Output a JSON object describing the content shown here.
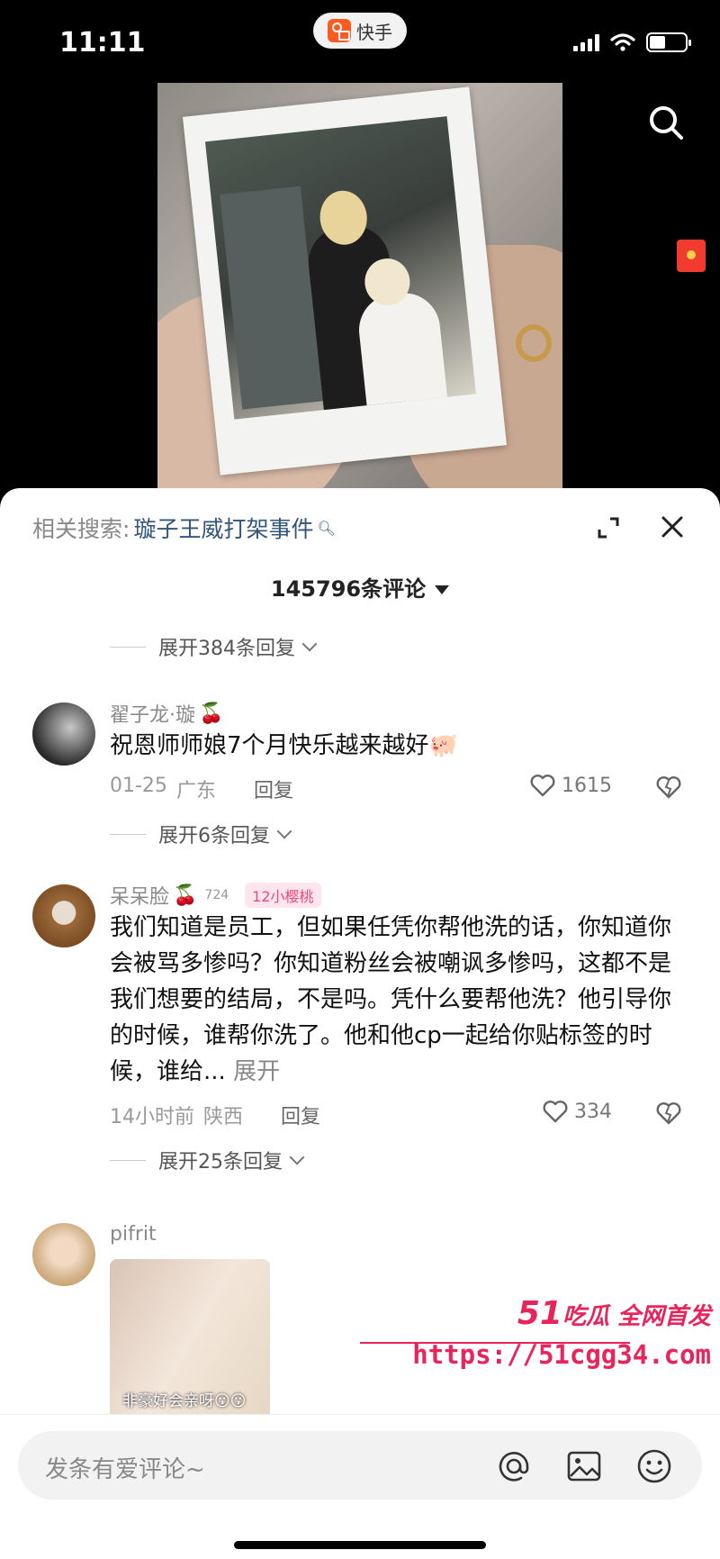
{
  "status_bar": {
    "time": "11:11",
    "app_name": "快手"
  },
  "related_search": {
    "label": "相关搜索:",
    "keyword": "璇子王威打架事件"
  },
  "comments_header": {
    "count_text": "145796条评论"
  },
  "replies_expand_1": "展开384条回复",
  "comments": [
    {
      "user": "翟子龙·璇",
      "text": "祝恩师师娘7个月快乐越来越好🐖",
      "date": "01-25",
      "location": "广东",
      "reply": "回复",
      "likes": "1615",
      "expand_replies": "展开6条回复"
    },
    {
      "user": "呆呆脸",
      "level": "724",
      "badge": "12小樱桃",
      "text": "我们知道是员工，但如果任凭你帮他洗的话，你知道你会被骂多惨吗？你知道粉丝会被嘲讽多惨吗，这都不是我们想要的结局，不是吗。凭什么要帮他洗？他引导你的时候，谁帮你洗了。他和他cp一起给你贴标签的时候，谁给...",
      "unfold": "展开",
      "date": "14小时前",
      "location": "陕西",
      "reply": "回复",
      "likes": "334",
      "expand_replies": "展开25条回复"
    },
    {
      "user": "pifrit",
      "image_caption": "非豪好会亲呀😗😗"
    }
  ],
  "watermark": {
    "line1_num": "51",
    "line1_text": "吃瓜 全网首发",
    "line2": "https://51cgg34.com"
  },
  "input": {
    "placeholder": "发条有爱评论~"
  },
  "colors": {
    "accent": "#e8245b",
    "link": "#33557a",
    "panel_bg": "#ffffff",
    "app_logo": "#ff5a1f"
  },
  "icons": [
    "search-icon",
    "red-packet-icon",
    "expand-icon",
    "close-icon",
    "heart-icon",
    "dislike-icon",
    "at-icon",
    "image-icon",
    "emoji-icon"
  ]
}
